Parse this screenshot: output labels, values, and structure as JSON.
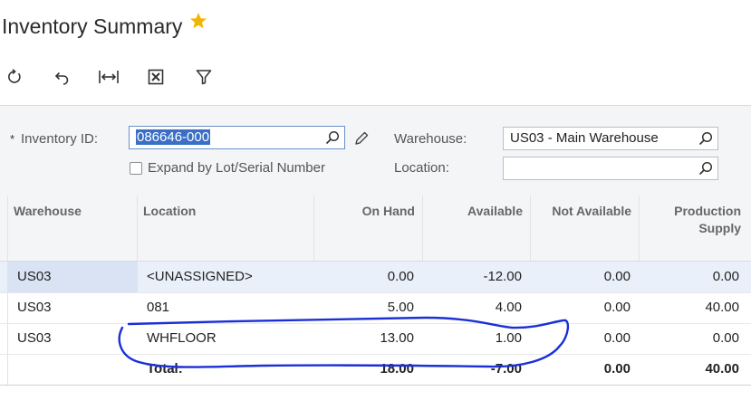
{
  "page": {
    "title": "Inventory Summary",
    "favorite_icon": "star-icon",
    "favorite_color": "#f2b600"
  },
  "toolbar": {
    "buttons": [
      {
        "icon": "refresh-icon",
        "name": "refresh-button"
      },
      {
        "icon": "undo-icon",
        "name": "undo-button"
      },
      {
        "icon": "fit-columns-icon",
        "name": "fit-to-screen-button"
      },
      {
        "icon": "excel-export-icon",
        "name": "export-excel-button"
      },
      {
        "icon": "filter-icon",
        "name": "filter-button"
      }
    ]
  },
  "form": {
    "inventory_id_required": "*",
    "inventory_id_label": "Inventory ID:",
    "inventory_id_value": "086646-000",
    "expand_label": "Expand by Lot/Serial Number",
    "expand_checked": false,
    "warehouse_label": "Warehouse:",
    "warehouse_value": "US03 - Main Warehouse",
    "location_label": "Location:",
    "location_value": ""
  },
  "grid": {
    "columns": [
      "Warehouse",
      "Location",
      "On Hand",
      "Available",
      "Not Available",
      "Production\nSupply"
    ],
    "rows": [
      {
        "warehouse": "US03",
        "location": "<UNASSIGNED>",
        "on_hand": "0.00",
        "available": "-12.00",
        "not_available": "0.00",
        "production_supply": "0.00",
        "selected": true
      },
      {
        "warehouse": "US03",
        "location": "081",
        "on_hand": "5.00",
        "available": "4.00",
        "not_available": "0.00",
        "production_supply": "40.00"
      },
      {
        "warehouse": "US03",
        "location": "WHFLOOR",
        "on_hand": "13.00",
        "available": "1.00",
        "not_available": "0.00",
        "production_supply": "0.00"
      }
    ],
    "total": {
      "label": "Total:",
      "on_hand": "18.00",
      "available": "-7.00",
      "not_available": "0.00",
      "production_supply": "40.00"
    }
  },
  "annotation": {
    "stroke_color": "#1a2fd6"
  }
}
